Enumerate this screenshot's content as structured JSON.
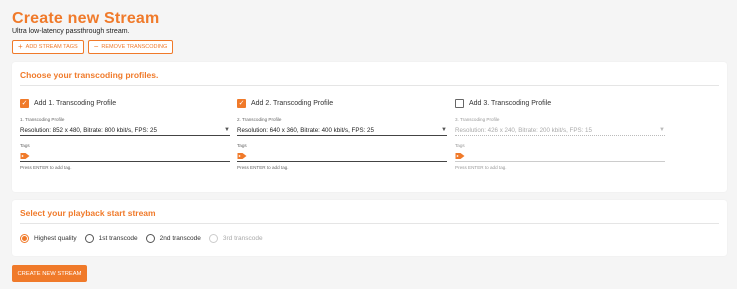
{
  "header": {
    "title": "Create new Stream",
    "subtitle": "Ultra low-latency passthrough stream."
  },
  "actions": {
    "add_tags_label": "ADD STREAM TAGS",
    "add_tags_icon": "plus-icon",
    "remove_transcoding_label": "REMOVE TRANSCODING",
    "remove_transcoding_icon": "minus-icon"
  },
  "profiles_section": {
    "title": "Choose your transcoding profiles.",
    "profiles": [
      {
        "checkbox_label": "Add 1. Transcoding Profile",
        "checked": true,
        "select_label": "1. Transcoding Profile",
        "select_value": "Resolution: 852 x 480, Bitrate: 800 kbit/s, FPS: 25",
        "tags_label": "Tags",
        "tags_hint": "Press ENTER to add tag."
      },
      {
        "checkbox_label": "Add 2. Transcoding Profile",
        "checked": true,
        "select_label": "2. Transcoding Profile",
        "select_value": "Resolution: 640 x 360, Bitrate: 400 kbit/s, FPS: 25",
        "tags_label": "Tags",
        "tags_hint": "Press ENTER to add tag."
      },
      {
        "checkbox_label": "Add 3. Transcoding Profile",
        "checked": false,
        "select_label": "3. Transcoding Profile",
        "select_value": "Resolution: 426 x 240, Bitrate: 200 kbit/s, FPS: 15",
        "tags_label": "Tags",
        "tags_hint": "Press ENTER to add tag."
      }
    ]
  },
  "playback_section": {
    "title": "Select your playback start stream",
    "options": [
      {
        "label": "Highest quality",
        "selected": true,
        "disabled": false
      },
      {
        "label": "1st transcode",
        "selected": false,
        "disabled": false
      },
      {
        "label": "2nd transcode",
        "selected": false,
        "disabled": false
      },
      {
        "label": "3rd transcode",
        "selected": false,
        "disabled": true
      }
    ]
  },
  "create_button_label": "CREATE NEW STREAM",
  "colors": {
    "accent": "#f07a2a",
    "background": "#f5f5f5",
    "card": "#ffffff"
  }
}
